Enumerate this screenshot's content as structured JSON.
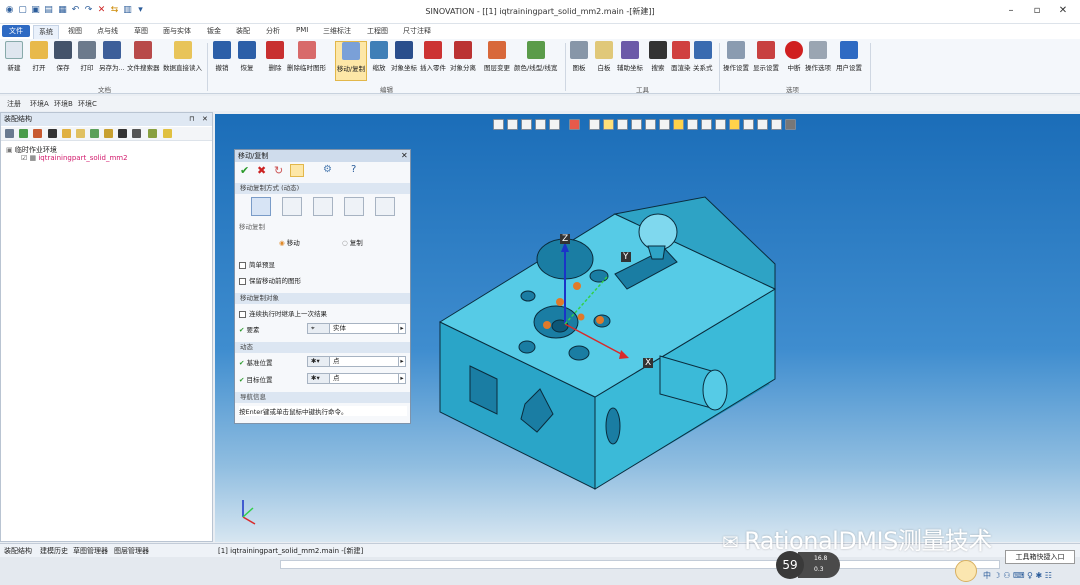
{
  "title_bar": {
    "title": "SINOVATION - [[1] iqtrainingpart_solid_mm2.main -[新建]]"
  },
  "app_button": {
    "label": "文件"
  },
  "ribbon_tabs": [
    "系统",
    "视图",
    "点与线",
    "草图",
    "面与实体",
    "钣金",
    "装配",
    "分析",
    "PMI",
    "三维标注",
    "工程图",
    "尺寸注释"
  ],
  "ribbon": {
    "buttons": [
      "新建",
      "打开",
      "保存",
      "打印",
      "另存为...",
      "文件搜索器",
      "数据直接读入",
      "撤销",
      "恢复",
      "删除",
      "删除临时图形",
      "移动/复制",
      "缩放",
      "对象坐标",
      "插入零件",
      "对象分离",
      "图层变更",
      "颜色/线型/线宽",
      "图板",
      "白板",
      "辅助坐标",
      "搜索",
      "面渲染",
      "关系式",
      "操作设置",
      "显示设置",
      "中断",
      "操作选项",
      "用户设置"
    ],
    "groups": [
      "文档",
      "编辑",
      "工具",
      "选项"
    ]
  },
  "env_tabs": [
    "注册",
    "环境A",
    "环境B",
    "环境C"
  ],
  "left_panel": {
    "title": "装配结构",
    "tree": [
      "临时作业环境",
      "iqtrainingpart_solid_mm2"
    ]
  },
  "bottom_tabs": [
    "装配结构",
    "建模历史",
    "草图管理器",
    "图层管理器"
  ],
  "dialog": {
    "title": "移动/复制",
    "section_mode": "移动复制方式 (动态)",
    "subsection": "移动复制",
    "option_move": "移动",
    "option_copy": "复制",
    "check_simple": "简单预显",
    "check_keep": "保留移动前的图形",
    "section_target": "移动复制对象",
    "check_continue": "连续执行时继承上一次结果",
    "element_label": "要素",
    "element_value": "实体",
    "section_dynamic": "动态",
    "base_label": "基准位置",
    "base_value": "点",
    "target_label": "目标位置",
    "target_value": "点",
    "section_nav": "导航信息",
    "nav_text": "按Enter键或单击鼠标中键执行命令。"
  },
  "viewport": {
    "axis_z": "Z",
    "axis_y": "Y",
    "axis_x": "X"
  },
  "statusbar": {
    "doc": "[1] iqtrainingpart_solid_mm2.main -[新建]"
  },
  "watermark": "RationalDMIS测量技术",
  "perf": {
    "value": "59",
    "up": "16.8",
    "down": "0.3"
  },
  "tooltip": "工具箱快捷入口",
  "colors": {
    "viewport_top": "#1b6db8",
    "part": "#36b6d4",
    "accent": "#2e6ac3"
  }
}
